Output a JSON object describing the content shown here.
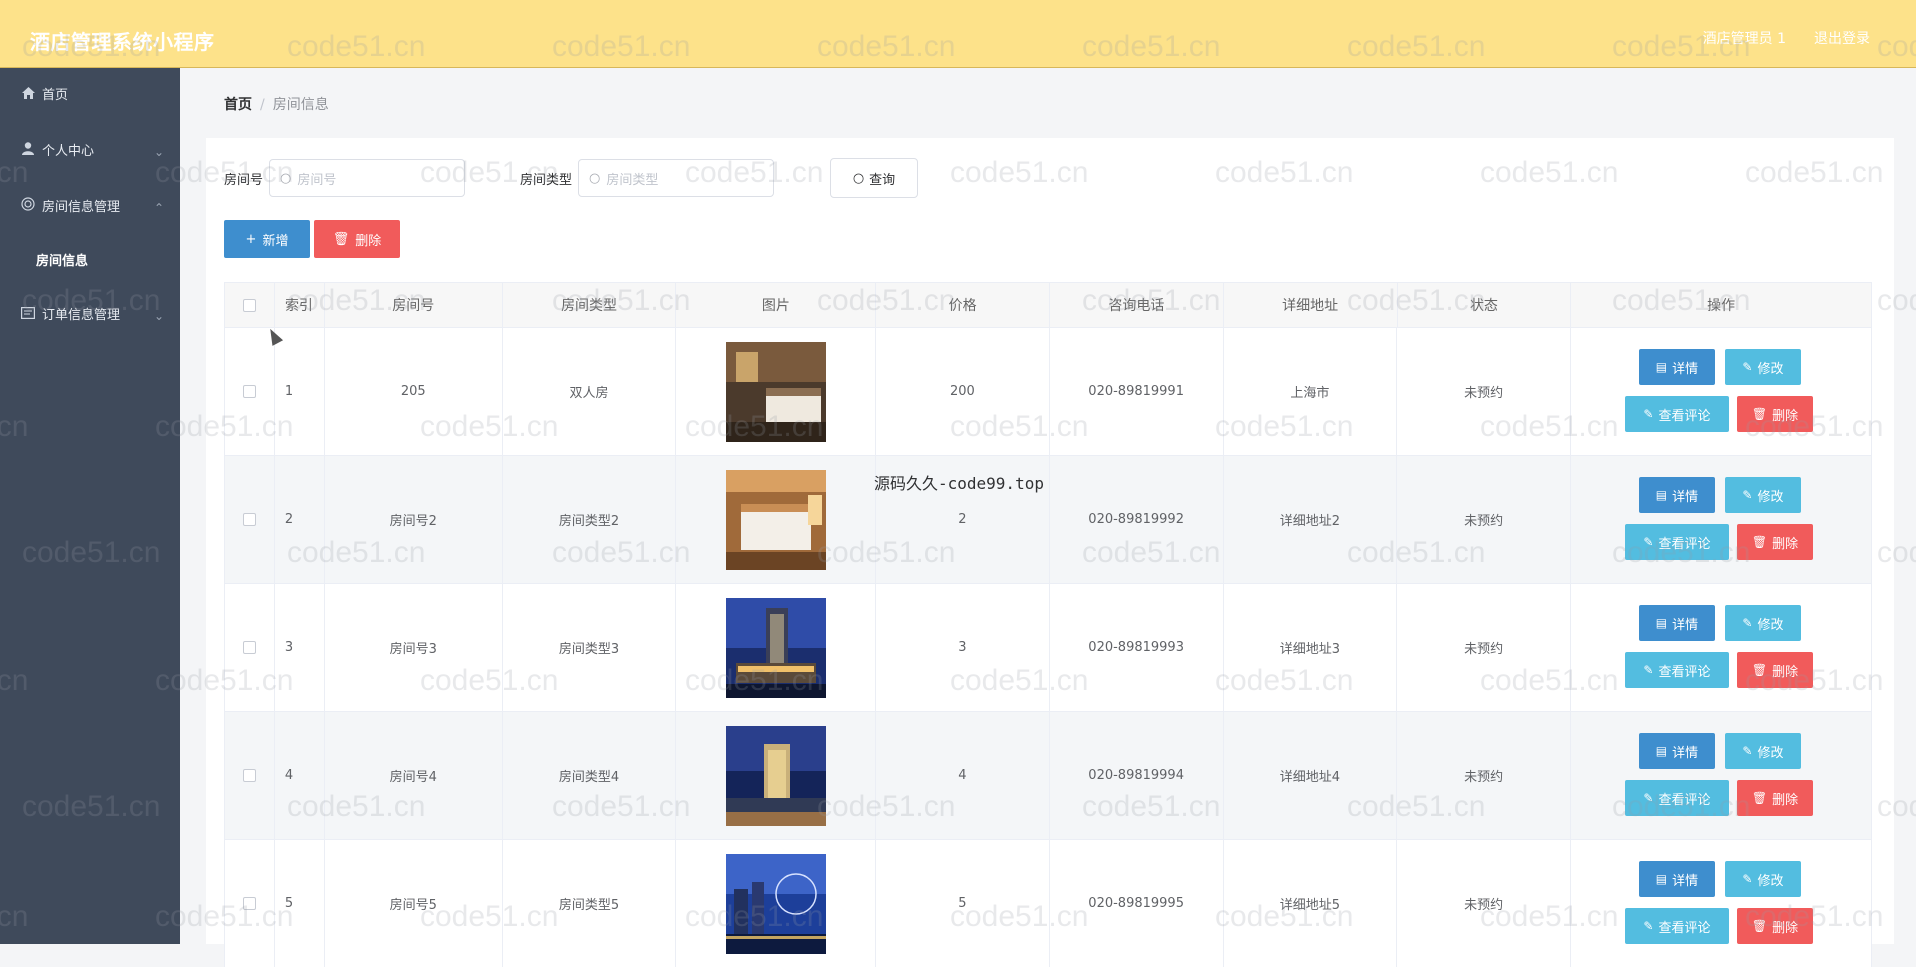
{
  "header": {
    "title": "酒店管理系统小程序",
    "user": "酒店管理员 1",
    "logout": "退出登录"
  },
  "sidebar": {
    "items": [
      {
        "label": "首页",
        "icon": "home-icon"
      },
      {
        "label": "个人中心",
        "icon": "user-icon"
      },
      {
        "label": "房间信息管理",
        "icon": "settings-icon"
      },
      {
        "label": "房间信息",
        "sub": true
      },
      {
        "label": "订单信息管理",
        "icon": "list-icon"
      }
    ]
  },
  "breadcrumb": {
    "home": "首页",
    "sep": "/",
    "current": "房间信息"
  },
  "search": {
    "room_no_label": "房间号",
    "room_no_placeholder": "房间号",
    "room_type_label": "房间类型",
    "room_type_placeholder": "房间类型",
    "query_button": "查询"
  },
  "actions": {
    "add": "新增",
    "delete": "删除"
  },
  "table": {
    "headers": [
      "索引",
      "房间号",
      "房间类型",
      "图片",
      "价格",
      "咨询电话",
      "详细地址",
      "状态",
      "操作"
    ],
    "row_buttons": {
      "detail": "详情",
      "edit": "修改",
      "review": "查看评论",
      "delete": "删除"
    },
    "rows": [
      {
        "index": "1",
        "room_no": "205",
        "room_type": "双人房",
        "price": "200",
        "phone": "020-89819991",
        "address": "上海市",
        "status": "未预约",
        "image": "hotel-room-photo"
      },
      {
        "index": "2",
        "room_no": "房间号2",
        "room_type": "房间类型2",
        "price": "2",
        "phone": "020-89819992",
        "address": "详细地址2",
        "status": "未预约",
        "image": "hotel-bedroom-photo"
      },
      {
        "index": "3",
        "room_no": "房间号3",
        "room_type": "房间类型3",
        "price": "3",
        "phone": "020-89819993",
        "address": "详细地址3",
        "status": "未预约",
        "image": "hotel-tower-night-photo"
      },
      {
        "index": "4",
        "room_no": "房间号4",
        "room_type": "房间类型4",
        "price": "4",
        "phone": "020-89819994",
        "address": "详细地址4",
        "status": "未预约",
        "image": "hotel-building-night-photo"
      },
      {
        "index": "5",
        "room_no": "房间号5",
        "room_type": "房间类型5",
        "price": "5",
        "phone": "020-89819995",
        "address": "详细地址5",
        "status": "未预约",
        "image": "city-skyline-night-photo"
      }
    ]
  },
  "overlay_text": "源码久久-code99.top",
  "watermark": "code51.cn",
  "colors": {
    "header_bg": "#fde28a",
    "sidebar_bg": "#3f4a5b",
    "primary": "#3e8ece",
    "info": "#53bde0",
    "danger": "#f15b5b"
  }
}
